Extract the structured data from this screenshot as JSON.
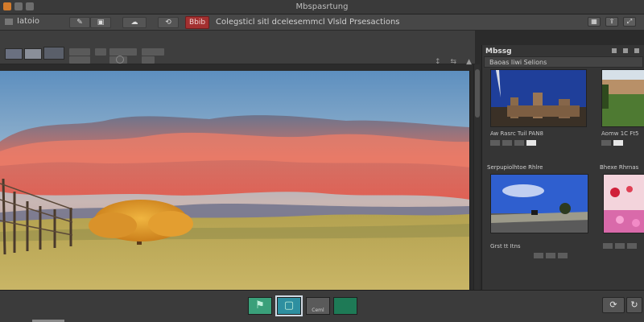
{
  "window": {
    "title": "Mbspasrtung"
  },
  "toolbar": {
    "mode_label": "Iatoio",
    "red_button_label": "Bbib",
    "status_text": "Colegsticl sitl dcelesemmcl Vlsld Prsesactions",
    "right_icons": [
      "grid-view-icon",
      "share-icon",
      "expand-icon"
    ]
  },
  "options_bar": {
    "tools_right": [
      "↕",
      "⇆",
      "▲"
    ]
  },
  "panel": {
    "title": "Mbssg",
    "header_label": "Baoas liwi Selions",
    "thumbnails": [
      {
        "name": "castle-scene",
        "caption": "Aw Rasrc Tuil PAN8"
      },
      {
        "name": "courtyard-scene",
        "caption": "Aomw 1C Ft5"
      },
      {
        "name": "road-scene",
        "caption": "Grst tt Itns"
      },
      {
        "name": "flower-scene",
        "caption": ""
      }
    ],
    "section_labels": [
      "Serpupiolhtoe Rhlre",
      "Bhexe Rhrnas"
    ]
  },
  "filmstrip": {
    "items": [
      {
        "name": "filmstrip-item-1",
        "caption": ""
      },
      {
        "name": "filmstrip-item-2",
        "caption": ""
      },
      {
        "name": "filmstrip-item-3",
        "caption": "Ceml"
      },
      {
        "name": "filmstrip-item-4",
        "caption": ""
      }
    ],
    "right_buttons": [
      "⟳",
      "↻"
    ]
  },
  "colors": {
    "accent_red": "#a33030",
    "panel_bg": "#353535",
    "toolbar_bg": "#474747"
  }
}
